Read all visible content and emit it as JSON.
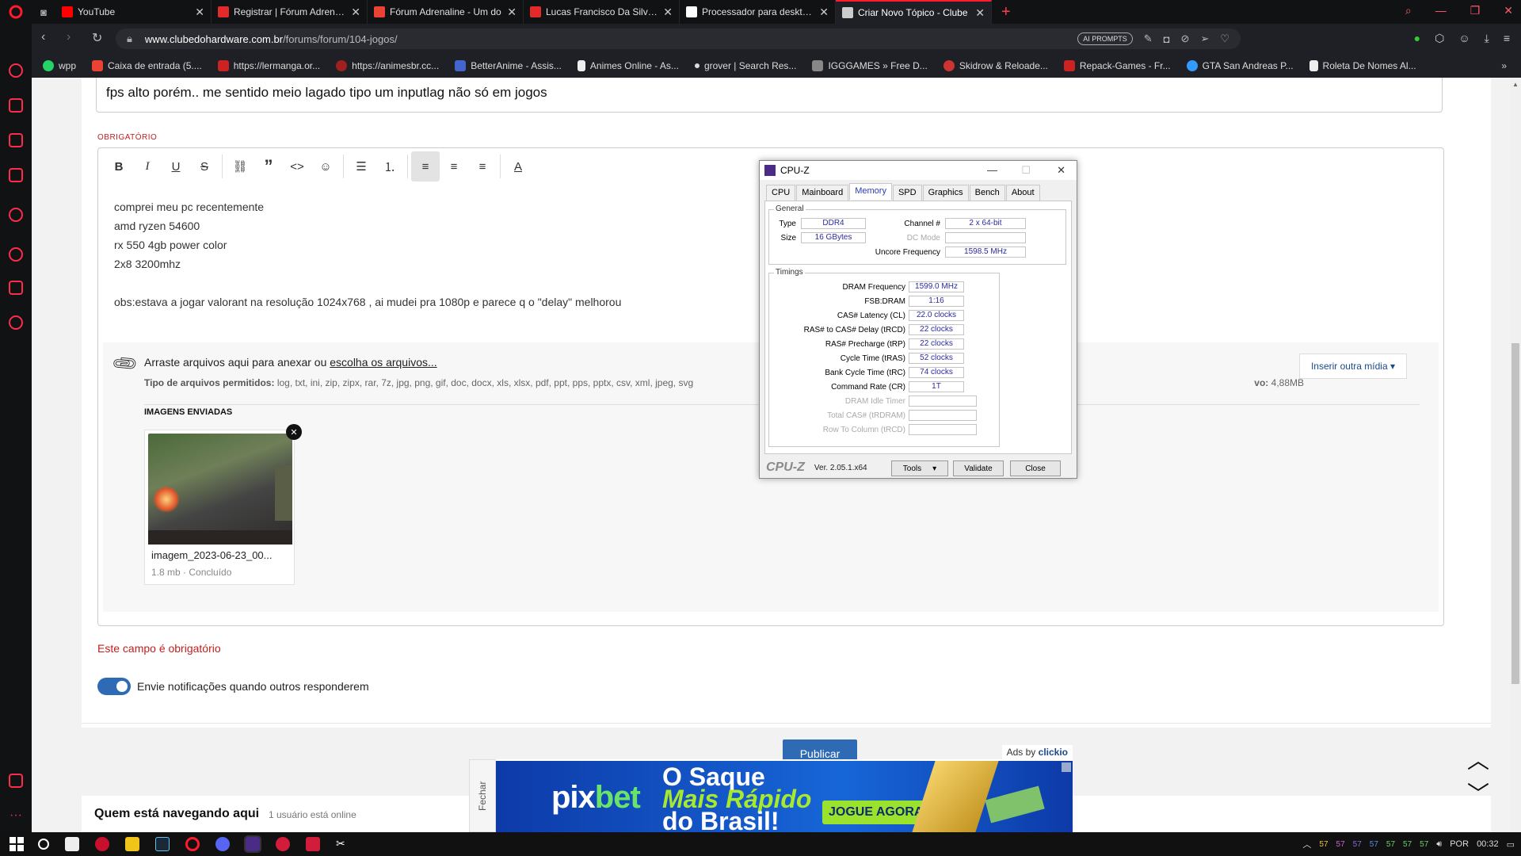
{
  "browser": {
    "tabs": [
      {
        "label": "YouTube",
        "icon": "youtube-icon",
        "color": "#ff0000"
      },
      {
        "label": "Registrar | Fórum Adrenalin",
        "icon": "adrenaline-icon",
        "color": "#e32a2a"
      },
      {
        "label": "Fórum Adrenaline - Um do",
        "icon": "gmail-icon",
        "color": "#ea4335"
      },
      {
        "label": "Lucas Francisco Da Silva | F",
        "icon": "adrenaline-icon",
        "color": "#e32a2a"
      },
      {
        "label": "Processador para desktop A",
        "icon": "amd-icon",
        "color": "#ffffff"
      },
      {
        "label": "Criar Novo Tópico - Clube",
        "icon": "clube-icon",
        "color": "#cccccc"
      }
    ],
    "url_domain": "www.clubedohardware.com.br",
    "url_path": "/forums/forum/104-jogos/",
    "ai_prompts": "AI PROMPTS",
    "bookmarks": [
      {
        "label": "wpp",
        "icon": "whatsapp-icon",
        "color": "#25d366"
      },
      {
        "label": "Caixa de entrada (5....",
        "icon": "gmail-icon",
        "color": "#ea4335"
      },
      {
        "label": "https://lermanga.or...",
        "icon": "lermanga-icon",
        "color": "#cc2222"
      },
      {
        "label": "https://animesbr.cc...",
        "icon": "animesbr-icon",
        "color": "#a02020"
      },
      {
        "label": "BetterAnime - Assis...",
        "icon": "betteranime-icon",
        "color": "#4466cc"
      },
      {
        "label": "Animes Online - As...",
        "icon": "animes-online-icon",
        "color": "#eeeeee"
      },
      {
        "label": "grover | Search Res...",
        "icon": "grover-icon",
        "color": "#dddddd"
      },
      {
        "label": "IGGGAMES » Free D...",
        "icon": "igggames-icon",
        "color": "#888888"
      },
      {
        "label": "Skidrow & Reloade...",
        "icon": "skidrow-icon",
        "color": "#cc3333"
      },
      {
        "label": "Repack-Games - Fr...",
        "icon": "repack-icon",
        "color": "#cc2222"
      },
      {
        "label": "GTA San Andreas P...",
        "icon": "gta-icon",
        "color": "#3399ff"
      },
      {
        "label": "Roleta De Nomes Al...",
        "icon": "page-icon",
        "color": "#eeeeee"
      }
    ]
  },
  "post": {
    "title_value": "fps alto porém.. me sentido meio lagado tipo um inputlag não só em jogos",
    "required_label": "OBRIGATÓRIO",
    "body_lines": [
      "comprei meu pc recentemente",
      "amd ryzen 54600",
      "rx 550 4gb power color",
      "2x8  3200mhz",
      "",
      "obs:estava a jogar valorant na resolução 1024x768 , ai mudei pra 1080p e parece q o \"delay\" melhorou"
    ],
    "attach_text": "Arraste arquivos aqui para anexar ou ",
    "attach_link": "escolha os arquivos...",
    "filetypes_label": "Tipo de arquivos permitidos:",
    "filetypes": "log, txt, ini, zip, zipx, rar, 7z, jpg, png, gif, doc, docx, xls, xlsx, pdf, ppt, pps, pptx, csv, xml, jpeg, svg",
    "max_size_fragment": "vo: ",
    "max_size": "4,88MB",
    "insert_media": "Inserir outra mídia ▾",
    "images_heading": "IMAGENS ENVIADAS",
    "image_name": "imagem_2023-06-23_00...",
    "image_meta": "1.8 mb · Concluído",
    "required_error": "Este campo é obrigatório",
    "notify_label": "Envie notificações quando outros responderem",
    "publish": "Publicar",
    "browsing_heading": "Quem está navegando aqui",
    "browsing_count": "1 usuário está online"
  },
  "cpuz": {
    "title": "CPU-Z",
    "tabs": [
      "CPU",
      "Mainboard",
      "Memory",
      "SPD",
      "Graphics",
      "Bench",
      "About"
    ],
    "active_tab": "Memory",
    "general_label": "General",
    "type_label": "Type",
    "type_value": "DDR4",
    "size_label": "Size",
    "size_value": "16 GBytes",
    "channel_label": "Channel #",
    "channel_value": "2 x 64-bit",
    "dcmode_label": "DC Mode",
    "dcmode_value": "",
    "uncore_label": "Uncore Frequency",
    "uncore_value": "1598.5 MHz",
    "timings_label": "Timings",
    "timings": [
      {
        "label": "DRAM Frequency",
        "value": "1599.0 MHz"
      },
      {
        "label": "FSB:DRAM",
        "value": "1:16"
      },
      {
        "label": "CAS# Latency (CL)",
        "value": "22.0 clocks"
      },
      {
        "label": "RAS# to CAS# Delay (tRCD)",
        "value": "22 clocks"
      },
      {
        "label": "RAS# Precharge (tRP)",
        "value": "22 clocks"
      },
      {
        "label": "Cycle Time (tRAS)",
        "value": "52 clocks"
      },
      {
        "label": "Bank Cycle Time (tRC)",
        "value": "74 clocks"
      },
      {
        "label": "Command Rate (CR)",
        "value": "1T"
      },
      {
        "label": "DRAM Idle Timer",
        "value": ""
      },
      {
        "label": "Total CAS# (tRDRAM)",
        "value": ""
      },
      {
        "label": "Row To Column (tRCD)",
        "value": ""
      }
    ],
    "logo": "CPU-Z",
    "version": "Ver. 2.05.1.x64",
    "tools_btn": "Tools",
    "validate_btn": "Validate",
    "close_btn": "Close"
  },
  "ad": {
    "label_prefix": "Ads by ",
    "label_brand": "clickio",
    "close_label": "Fechar",
    "brand_a": "pix",
    "brand_b": "bet",
    "headline1": "O Saque",
    "headline2": "Mais Rápido",
    "headline3": "do Brasil!",
    "cta": "JOGUE AGORA"
  },
  "taskbar": {
    "tray_numbers": [
      "57",
      "57",
      "57",
      "57",
      "57",
      "57",
      "57"
    ],
    "language": "POR",
    "time": "00:32"
  }
}
